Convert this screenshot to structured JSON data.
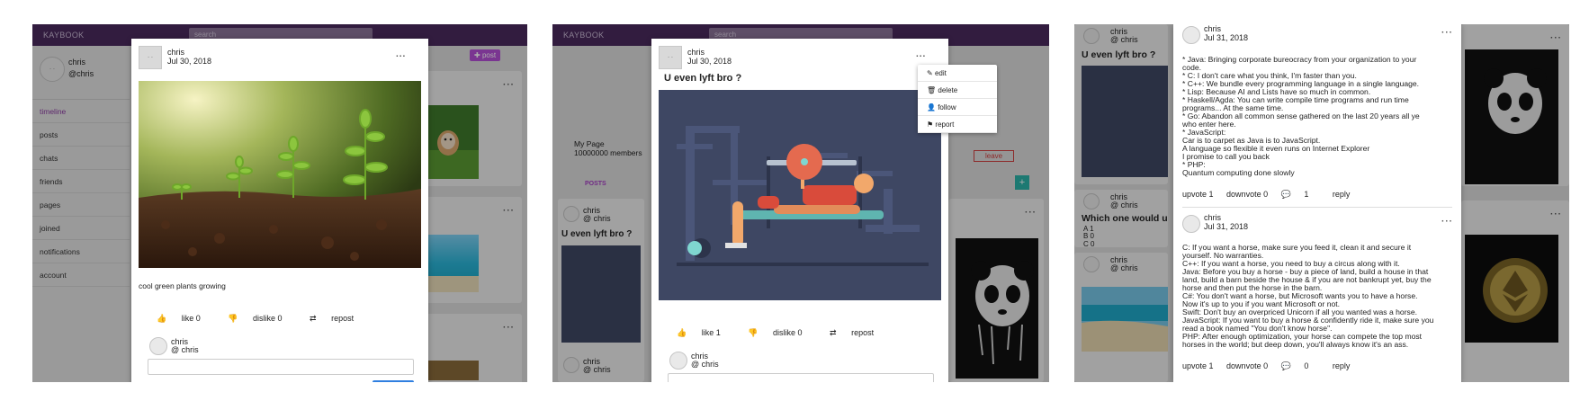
{
  "app": {
    "brand": "KAYBOOK",
    "search_placeholder": "search"
  },
  "panel1": {
    "profile": {
      "name": "chris",
      "handle": "@chris"
    },
    "sidebar": [
      {
        "label": "timeline"
      },
      {
        "label": "posts"
      },
      {
        "label": "chats"
      },
      {
        "label": "friends"
      },
      {
        "label": "pages"
      },
      {
        "label": "joined"
      },
      {
        "label": "notifications"
      },
      {
        "label": "account"
      }
    ],
    "post_button": "post",
    "modal": {
      "author": "chris",
      "date": "Jul 30, 2018",
      "menu": "...",
      "caption": "cool green plants growing",
      "like": "like 0",
      "dislike": "dislike 0",
      "repost": "repost",
      "commenter_name": "chris",
      "commenter_handle": "@ chris"
    }
  },
  "panel2": {
    "page_name": "My Page",
    "members": "10000000 members",
    "leave": "leave",
    "tab_posts": "POSTS",
    "add": "+",
    "card": {
      "name": "chris",
      "handle": "@ chris",
      "title": "U even lyft bro ?",
      "name2": "chris",
      "handle2": "@ chris"
    },
    "modal": {
      "author": "chris",
      "date": "Jul 30, 2018",
      "menu": "...",
      "title": "U even lyft bro ?",
      "like": "like 1",
      "dislike": "dislike 0",
      "repost": "repost",
      "commenter_name": "chris",
      "commenter_handle": "@ chris"
    },
    "dropdown": [
      {
        "icon": "edit-icon",
        "label": "edit"
      },
      {
        "icon": "trash-icon",
        "label": "delete"
      },
      {
        "icon": "user-plus-icon",
        "label": "follow"
      },
      {
        "icon": "flag-icon",
        "label": "report"
      }
    ]
  },
  "panel3": {
    "cards": [
      {
        "name": "chris",
        "handle": "@ chris",
        "title": "U even lyft bro ?"
      },
      {
        "name": "chris",
        "handle": "@ chris",
        "title": "Which one would u",
        "options": [
          "A 1",
          "B 0",
          "C 0"
        ]
      },
      {
        "name": "chris",
        "handle": "@ chris"
      }
    ],
    "comments": [
      {
        "author": "chris",
        "date": "Jul 31, 2018",
        "text": "* Java: Bringing corporate bureocracy from your organization to your\ncode.\n* C: I don't care what you think, I'm faster than you.\n* C++: We bundle every programming language in a single language.\n* Lisp: Because AI and Lists have so much in common.\n* Haskell/Agda: You can write compile time programs and run time\nprograms... At the same time.\n* Go: Abandon all common sense gathered on the last 20 years all ye\nwho enter here.\n* JavaScript:\nCar is to carpet as Java is to JavaScript.\nA language so flexible it even runs on Internet Explorer\nI promise to call you back\n* PHP:\nQuantum computing done slowly",
        "upvote": "upvote 1",
        "downvote": "downvote 0",
        "replies": "1",
        "reply": "reply"
      },
      {
        "author": "chris",
        "date": "Jul 31, 2018",
        "text": "C: If you want a horse, make sure you feed it, clean it and secure it\nyourself. No warranties.\nC++: If you want a horse, you need to buy a circus along with it.\nJava: Before you buy a horse - buy a piece of land, build a house in that\nland, build a barn beside the house & if you are not bankrupt yet, buy the\nhorse and then put the horse in the barn.\nC#: You don't want a horse, but Microsoft wants you to have a horse.\nNow it's up to you if you want Microsoft or not.\nSwift: Don't buy an overpriced Unicorn if all you wanted was a horse.\nJavaScript: If you want to buy a horse & confidently ride it, make sure you\nread a book named \"You don't know horse\".\nPHP: After enough optimization, your horse can compete the top most\nhorses in the world; but deep down, you'll always know it's an ass.",
        "upvote": "upvote 1",
        "downvote": "downvote 0",
        "replies": "0",
        "reply": "reply"
      }
    ]
  },
  "thumb_label": "- -",
  "colors": {
    "topbar": "#4a2a5e",
    "accent": "#b44fd6",
    "active_link": "#8a3aa0",
    "teal": "#2bb3a8"
  }
}
